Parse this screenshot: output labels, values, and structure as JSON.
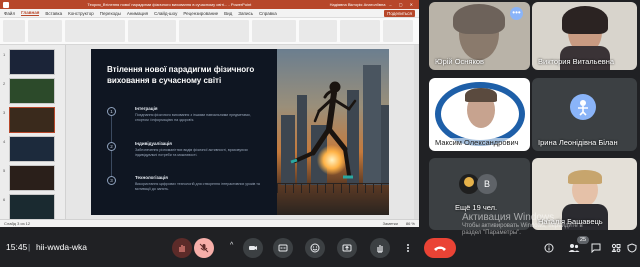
{
  "powerpoint": {
    "title_doc": "Теория_Втілення нової парадигми фізичного виховання в сучасному світі... - PowerPoint",
    "title_user": "Надіявна Вікторія Анатоліївна",
    "menu": [
      "Файл",
      "Главная",
      "Вставка",
      "Конструктор",
      "Переходы",
      "Анимация",
      "Слайд-шоу",
      "Рецензирование",
      "Вид",
      "Запись",
      "Справка"
    ],
    "menu_active": "Главная",
    "share_label": "Поделиться",
    "thumb_numbers": [
      "1",
      "2",
      "3",
      "4",
      "5",
      "6",
      "7"
    ],
    "status_left": "Слайд 3 из 12",
    "status_mid": "Заметки",
    "status_right": "86 %"
  },
  "slide": {
    "title": "Втілення нової парадигми фізичного виховання в сучасному світі",
    "items": [
      {
        "num": "1",
        "heading": "Інтеграція",
        "text": "Поєднання фізичного виховання з іншими навчальними предметами, спортом і інформацією на здоров'я."
      },
      {
        "num": "2",
        "heading": "Індивідуалізація",
        "text": "Забезпечення різноманітних видів фізичної активності, враховуючи індивідуальні потреби та можливості."
      },
      {
        "num": "3",
        "heading": "Технологізація",
        "text": "Використання цифрових технологій для створення інтерактивних уроків та мотивації до занять."
      }
    ]
  },
  "participants": [
    {
      "name": "Юрій Осняков"
    },
    {
      "name": "Виктория Витальевна"
    },
    {
      "name": "Максим Олександрович"
    },
    {
      "name": "Ірина Леонідівна Білан"
    },
    {
      "name": "Ещё 19 чел."
    },
    {
      "name": "Наталія Башавець"
    }
  ],
  "others_avatar_letter": "B",
  "watermark": {
    "line1": "Активация Windows",
    "line2": "Чтобы активировать Windows, перейдите в",
    "line3": "раздел \"Параметры\"."
  },
  "bottom_bar": {
    "time": "15:45",
    "separator": "|",
    "meeting_code": "hii-wwda-wka",
    "participants_badge": "25"
  },
  "icons": {
    "hand": "raise-hand-icon",
    "mic": "mic-off-icon",
    "cam": "camera-icon",
    "captions": "captions-icon",
    "emoji": "emoji-icon",
    "present": "present-icon",
    "more": "more-vert-icon",
    "end": "call-end-icon",
    "info": "info-icon",
    "people": "people-icon",
    "chat": "chat-icon",
    "activities": "activities-icon",
    "host": "host-controls-icon"
  },
  "colors": {
    "accent_blue": "#8ab4f8",
    "end_call": "#ea4335",
    "ppt_brand": "#b7472a",
    "bg": "#202124"
  }
}
